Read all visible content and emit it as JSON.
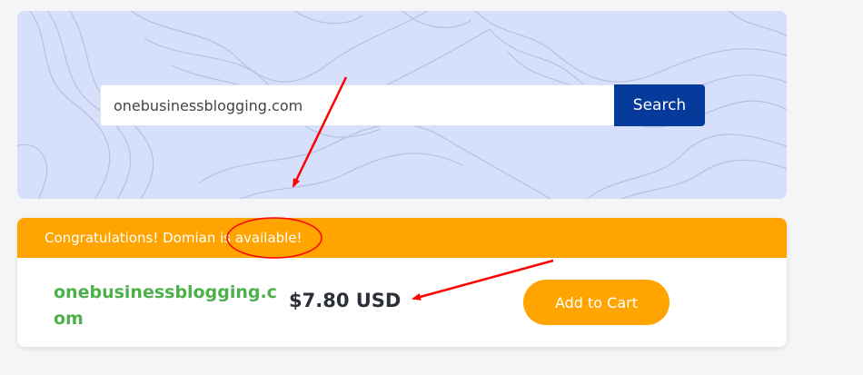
{
  "search": {
    "value": "onebusinessblogging.com",
    "button_label": "Search"
  },
  "result": {
    "message_start": "Congratulations! Domian ",
    "message_highlight": "is available!",
    "domain": "onebusinessblogging.com",
    "price": "$7.80 USD",
    "add_to_cart_label": "Add to Cart"
  },
  "colors": {
    "hero_background": "#d6e0fb",
    "search_button": "#063a9b",
    "banner": "#ffa400",
    "domain_text": "#4cb14b",
    "annotation": "#ff0000"
  },
  "icons": [
    "topographic-pattern",
    "annotation-arrow",
    "annotation-ellipse"
  ]
}
